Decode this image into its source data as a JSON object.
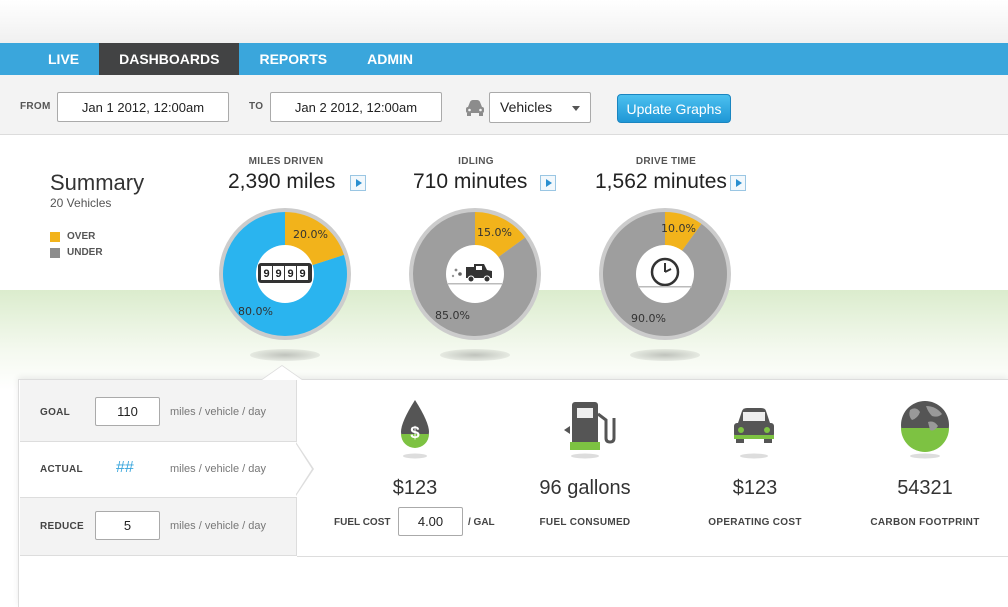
{
  "nav": {
    "items": [
      {
        "label": "LIVE",
        "active": false
      },
      {
        "label": "DASHBOARDS",
        "active": true
      },
      {
        "label": "REPORTS",
        "active": false
      },
      {
        "label": "ADMIN",
        "active": false
      }
    ]
  },
  "filters": {
    "from_label": "FROM",
    "from_value": "Jan 1 2012, 12:00am",
    "to_label": "TO",
    "to_value": "Jan 2 2012, 12:00am",
    "vehicle_icon": "car-icon",
    "vehicle_select": "Vehicles",
    "update_button": "Update Graphs"
  },
  "summary": {
    "title": "Summary",
    "subtitle": "20 Vehicles",
    "legend": [
      {
        "label": "OVER",
        "color": "#f2b31b"
      },
      {
        "label": "UNDER",
        "color": "#8c8c8c"
      }
    ]
  },
  "metrics": [
    {
      "label": "MILES DRIVEN",
      "value": "2,390 miles",
      "over_pct": 20.0,
      "under_pct": 80.0,
      "over_label": "20.0%",
      "under_label": "80.0%",
      "under_color": "#2ab4ef",
      "icon": "odometer-icon",
      "odometer": [
        "9",
        "9",
        "9",
        "9"
      ]
    },
    {
      "label": "IDLING",
      "value": "710 minutes",
      "over_pct": 15.0,
      "under_pct": 85.0,
      "over_label": "15.0%",
      "under_label": "85.0%",
      "under_color": "#9e9e9e",
      "icon": "idling-truck-icon"
    },
    {
      "label": "DRIVE TIME",
      "value": "1,562 minutes",
      "over_pct": 10.0,
      "under_pct": 90.0,
      "over_label": "10.0%",
      "under_label": "90.0%",
      "under_color": "#9e9e9e",
      "icon": "clock-icon"
    }
  ],
  "colors": {
    "over": "#f2b31b",
    "accent": "#3aa6dc",
    "green": "#7dc242"
  },
  "goals": {
    "goal_label": "GOAL",
    "goal_value": "110",
    "actual_label": "ACTUAL",
    "actual_value": "##",
    "reduce_label": "REDUCE",
    "reduce_value": "5",
    "unit": "miles / vehicle / day"
  },
  "stats": [
    {
      "icon": "fuel-drop-dollar-icon",
      "value": "$123",
      "label": "FUEL COST"
    },
    {
      "icon": "gas-pump-icon",
      "value": "96 gallons",
      "label": "FUEL CONSUMED"
    },
    {
      "icon": "car-front-icon",
      "value": "$123",
      "label": "OPERATING COST"
    },
    {
      "icon": "globe-icon",
      "value": "54321",
      "label": "CARBON FOOTPRINT"
    }
  ],
  "fuel_cost": {
    "input_value": "4.00",
    "unit": "/ GAL"
  }
}
